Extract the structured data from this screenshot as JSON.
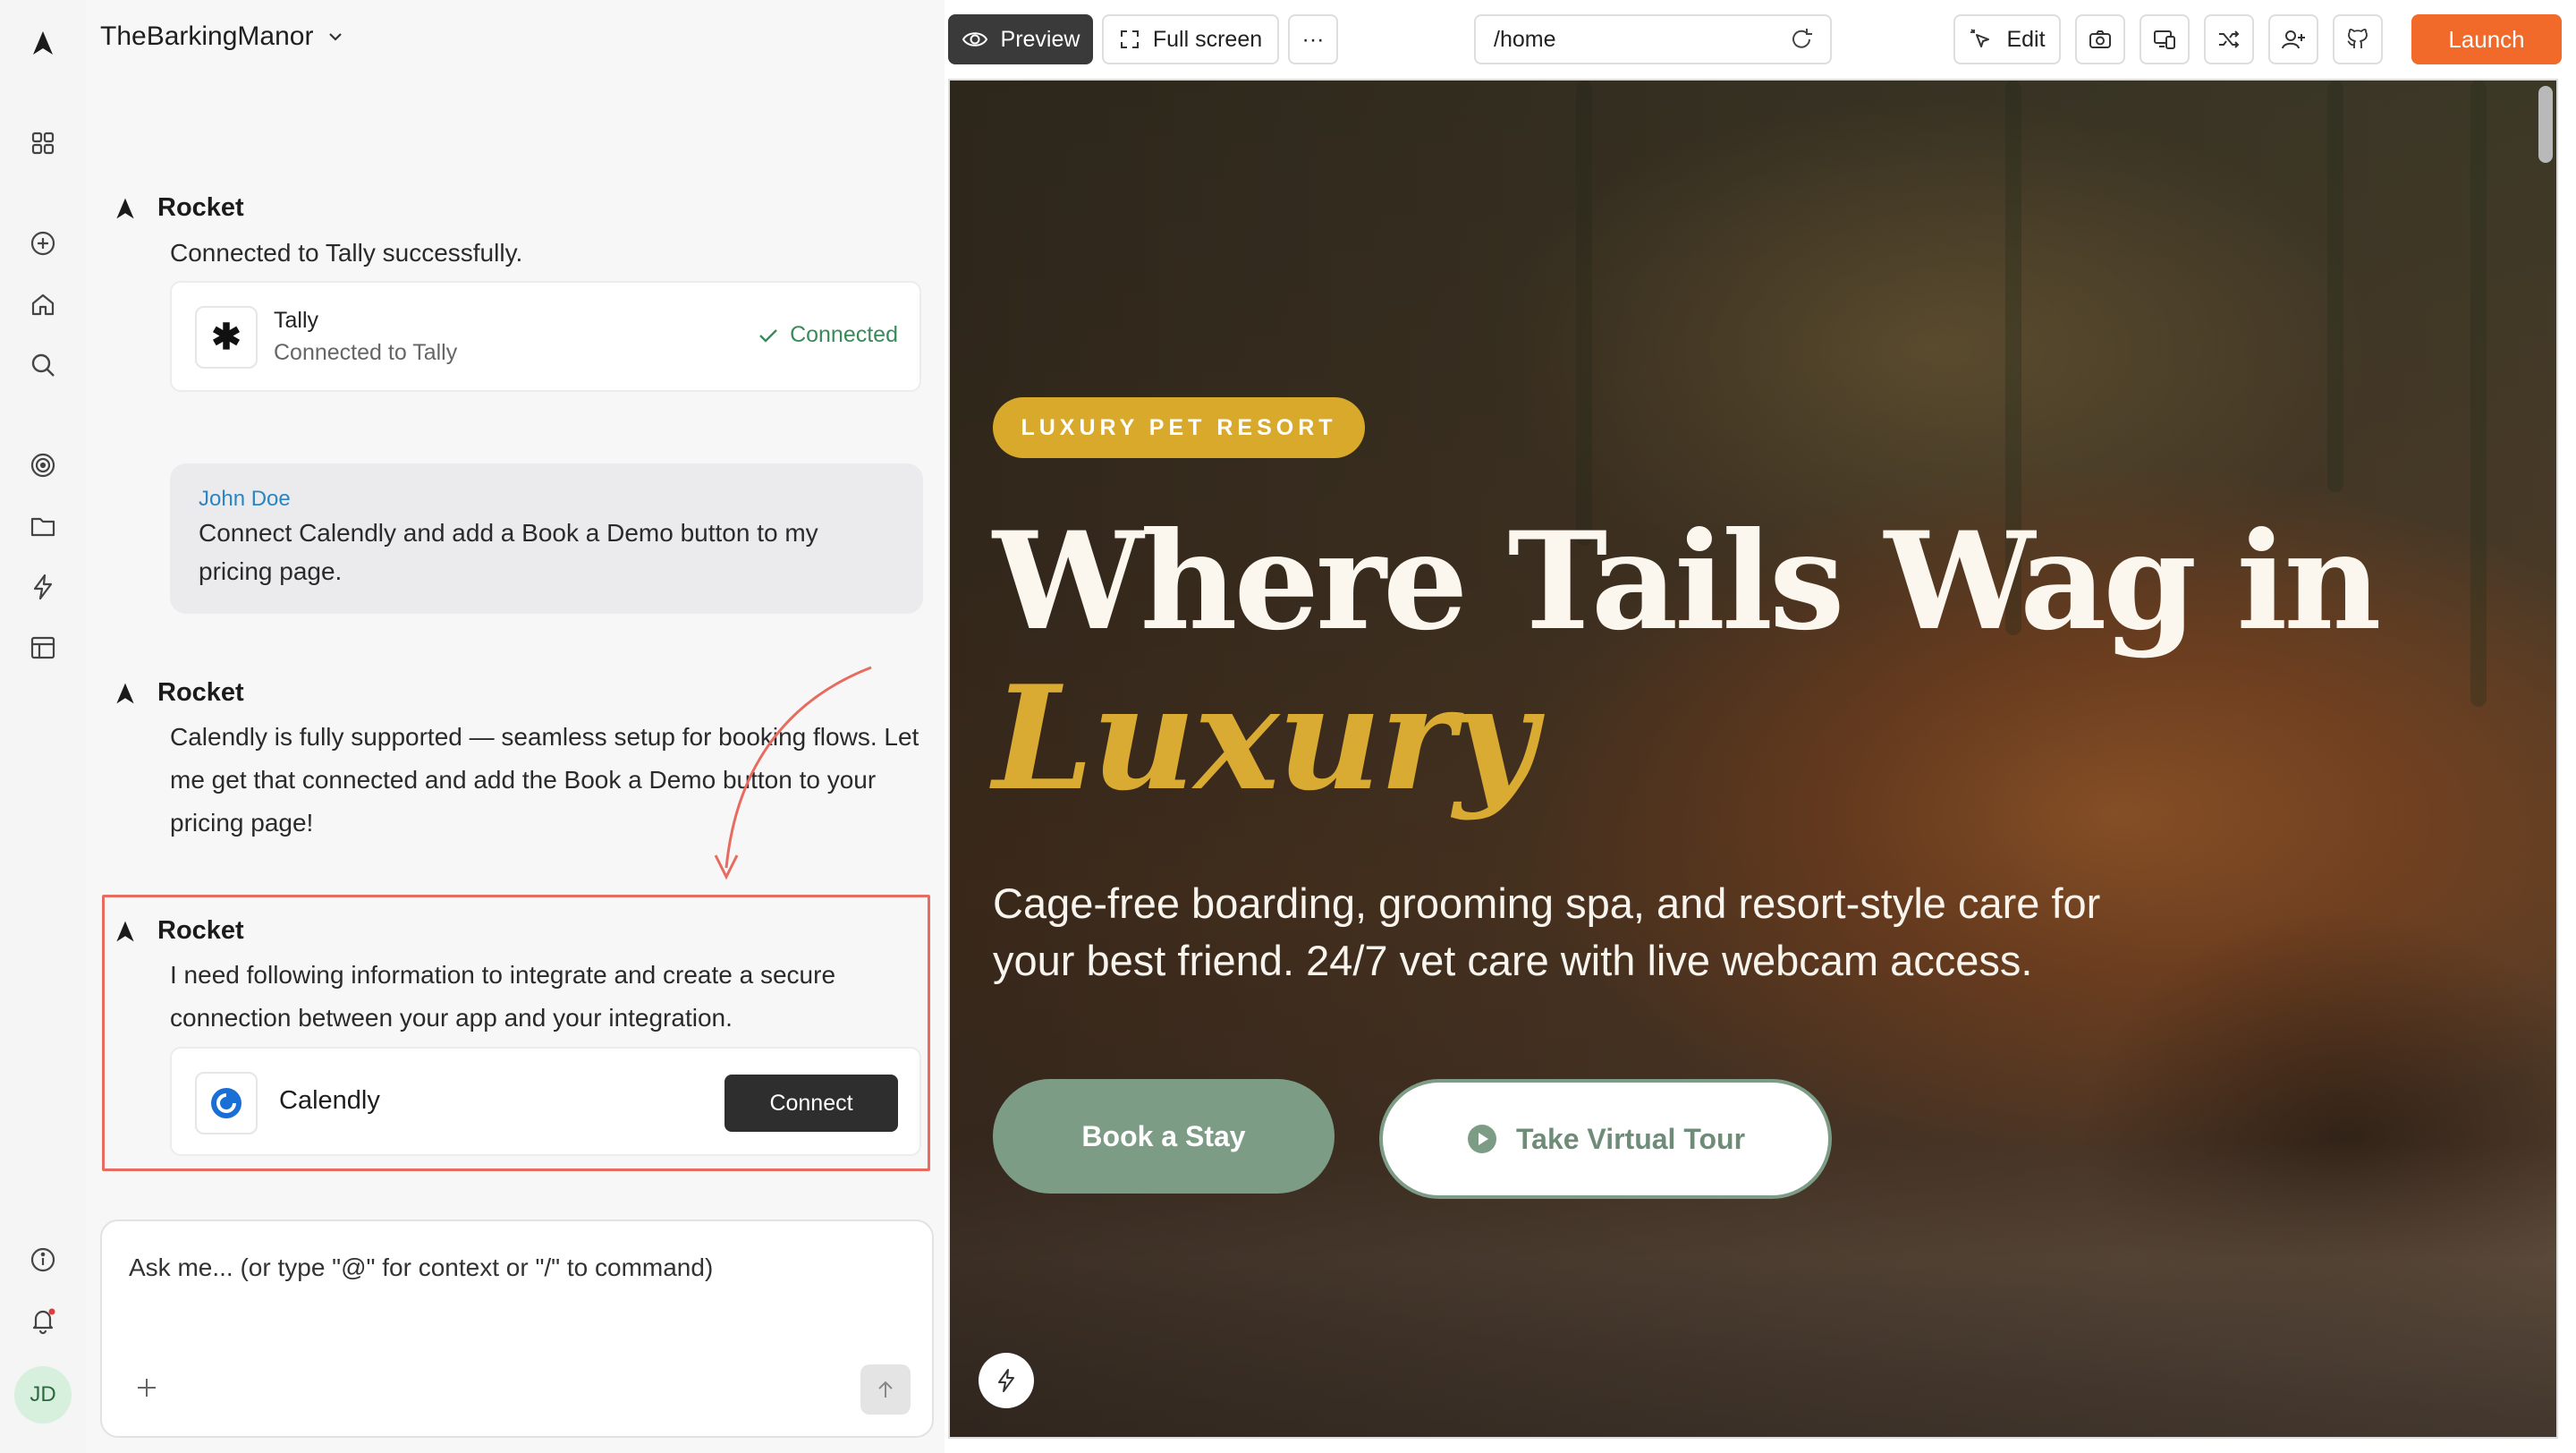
{
  "app": {
    "project_name": "TheBarkingManor",
    "user_initials": "JD",
    "colors": {
      "accent": "#f26a2a",
      "highlight_border": "#e86b60",
      "brand_gold": "#d9ab33",
      "sage": "#7d9c86",
      "link_blue": "#2a85c4"
    }
  },
  "sidebar": {
    "icons": [
      "grid-icon",
      "plus-circle-icon",
      "home-icon",
      "search-icon",
      "target-icon",
      "folder-icon",
      "lightning-icon",
      "layout-icon",
      "info-icon",
      "bell-icon"
    ]
  },
  "chat": {
    "messages": [
      {
        "author": "Rocket",
        "text": "Connected to Tally successfully."
      },
      {
        "author": "John Doe",
        "text": "Connect Calendly and add a Book a Demo button to my pricing page."
      },
      {
        "author": "Rocket",
        "text": "Calendly is fully supported — seamless setup for booking flows. Let me get that connected and add the Book a Demo button to your pricing page!"
      },
      {
        "author": "Rocket",
        "text": "I need following information to integrate and create a secure connection between your app and your integration."
      }
    ],
    "tally_card": {
      "name": "Tally",
      "subtitle": "Connected to Tally",
      "status": "Connected"
    },
    "calendly_card": {
      "name": "Calendly",
      "button": "Connect"
    },
    "composer": {
      "placeholder": "Ask me... (or type \"@\" for context or \"/\" to command)"
    }
  },
  "toolbar": {
    "preview": "Preview",
    "fullscreen": "Full screen",
    "more": "···",
    "url": "/home",
    "edit": "Edit",
    "launch": "Launch"
  },
  "hero": {
    "badge": "LUXURY PET RESORT",
    "title_line1": "Where Tails Wag in",
    "title_line2": "Luxury",
    "subtitle": "Cage-free boarding, grooming spa, and resort-style care for your best friend. 24/7 vet care with live webcam access.",
    "primary_cta": "Book a Stay",
    "secondary_cta": "Take Virtual Tour"
  }
}
